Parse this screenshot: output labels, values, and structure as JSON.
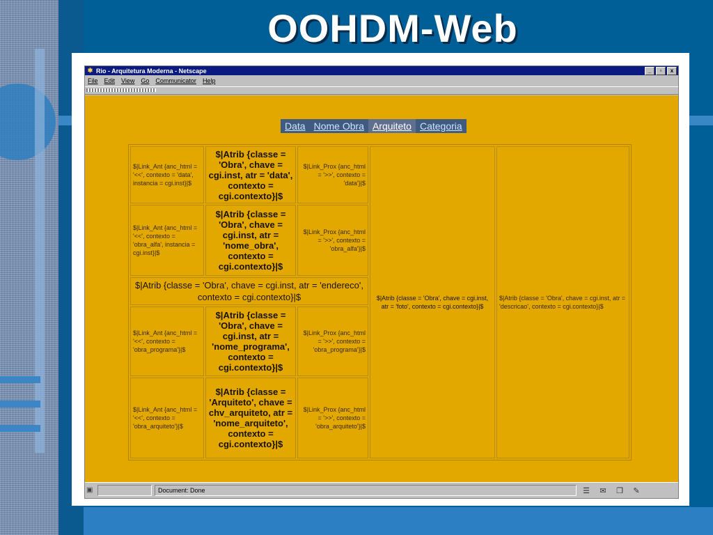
{
  "slide": {
    "title": "OOHDM-Web"
  },
  "browser": {
    "window_title": "Rio - Arquitetura Moderna - Netscape",
    "controls": {
      "minimize": "_",
      "maximize": "▫",
      "close": "x"
    },
    "menu": [
      "File",
      "Edit",
      "View",
      "Go",
      "Communicator",
      "Help"
    ],
    "status": "Document: Done"
  },
  "nav": [
    "Data",
    "Nome Obra",
    "Arquiteto",
    "Categoria"
  ],
  "rows": {
    "r1": {
      "left": "$|Link_Ant {anc_html = '<<', contexto = 'data', instancia = cgi.inst}|$",
      "mid": "$|Atrib {classe = 'Obra', chave = cgi.inst, atr = 'data', contexto = cgi.contexto}|$",
      "right": "$|Link_Prox {anc_html = '>>', contexto = 'data'}|$"
    },
    "r2": {
      "left": "$|Link_Ant {anc_html = '<<', contexto = 'obra_alfa', instancia = cgi.inst}|$",
      "mid": "$|Atrib {classe = 'Obra', chave = cgi.inst, atr = 'nome_obra', contexto = cgi.contexto}|$",
      "right": "$|Link_Prox {anc_html = '>>', contexto = 'obra_alfa'}|$"
    },
    "r3": {
      "wide": "$|Atrib {classe = 'Obra', chave = cgi.inst, atr = 'endereco', contexto = cgi.contexto}|$"
    },
    "r4": {
      "left": "$|Link_Ant {anc_html = '<<', contexto = 'obra_programa'}|$",
      "mid": "$|Atrib {classe = 'Obra', chave = cgi.inst, atr = 'nome_programa', contexto = cgi.contexto}|$",
      "right": "$|Link_Prox {anc_html = '>>', contexto = 'obra_programa'}|$"
    },
    "r5": {
      "left": "$|Link_Ant {anc_html = '<<', contexto = 'obra_arquiteto'}|$",
      "mid": "$|Atrib {classe = 'Arquiteto', chave = chv_arquiteto, atr = 'nome_arquiteto', contexto = cgi.contexto}|$",
      "right": "$|Link_Prox {anc_html = '>>', contexto = 'obra_arquiteto'}|$"
    }
  },
  "foto_cell": "$|Atrib {classe = 'Obra', chave = cgi.inst, atr = 'foto', contexto = cgi.contexto}|$",
  "descricao_cell": "$|Atrib {classe = 'Obra', chave = cgi.inst, atr = 'descricao', contexto = cgi.contexto}|$"
}
